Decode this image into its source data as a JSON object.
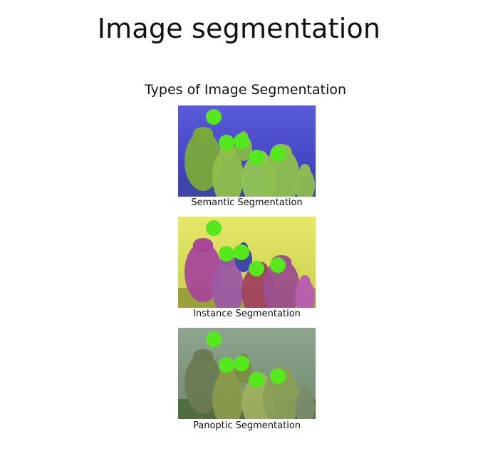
{
  "title": "Image segmentation",
  "subtitle": "Types of Image Segmentation",
  "panels": [
    {
      "caption": "Semantic Segmentation",
      "sky_colors": [
        "#5a5bd8",
        "#3a3ab8"
      ],
      "ground_color": "#3e44a8",
      "people_colors": [
        "#7aaa3a",
        "#8fbf4a",
        "#86b948",
        "#93c656",
        "#8ec04e",
        "#8dbd52"
      ],
      "face_color": "#55e81c"
    },
    {
      "caption": "Instance Segmentation",
      "sky_colors": [
        "#e6e86a",
        "#c9cf4e"
      ],
      "ground_color": "#9aa13a",
      "people_colors": [
        "#a8479a",
        "#9c5aa4",
        "#3a3fae",
        "#a0425e",
        "#9d4f8e",
        "#b85fb0"
      ],
      "face_color": "#55e81c"
    },
    {
      "caption": "Panoptic Segmentation",
      "sky_colors": [
        "#8fa48e",
        "#6f8a6f"
      ],
      "ground_color": "#4f6d3f",
      "people_colors": [
        "#6a7a52",
        "#8a9a4a",
        "#7c8c44",
        "#9fb060",
        "#8a9e58",
        "#7a8c6a"
      ],
      "face_color": "#55e81c"
    }
  ]
}
